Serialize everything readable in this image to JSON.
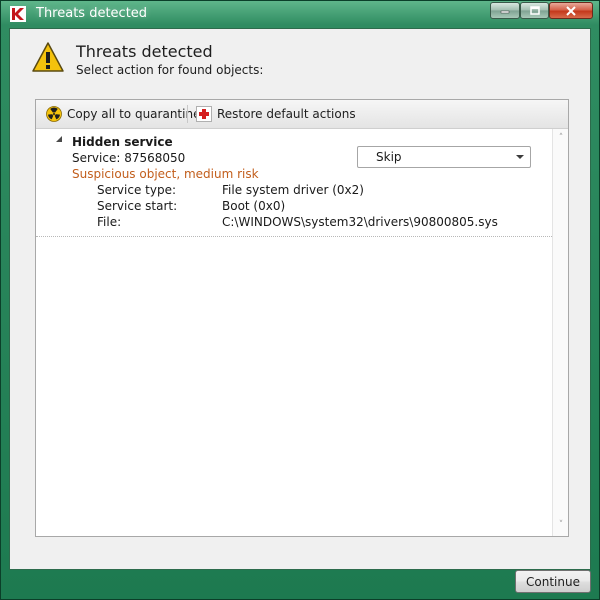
{
  "window": {
    "title": "Threats detected",
    "icon": "kaspersky-k-icon"
  },
  "header": {
    "icon": "warning-triangle-icon",
    "title": "Threats detected",
    "subtitle": "Select action for found objects:"
  },
  "toolbar": {
    "copy_label": "Copy all to quarantine",
    "copy_icon": "radiation-icon",
    "restore_label": "Restore default actions",
    "restore_icon": "red-cross-icon"
  },
  "threats": [
    {
      "name": "Hidden service",
      "service": "Service: 87568050",
      "risk": "Suspicious object, medium risk",
      "details": [
        {
          "label": "Service type:",
          "value": "File system driver (0x2)"
        },
        {
          "label": "Service start:",
          "value": "Boot (0x0)"
        },
        {
          "label": "File:",
          "value": "C:\\WINDOWS\\system32\\drivers\\90800805.sys"
        }
      ],
      "action": "Skip"
    }
  ],
  "footer": {
    "continue_label": "Continue"
  },
  "colors": {
    "risk": "#c25e1c",
    "window_frame": "#1d7a50"
  }
}
